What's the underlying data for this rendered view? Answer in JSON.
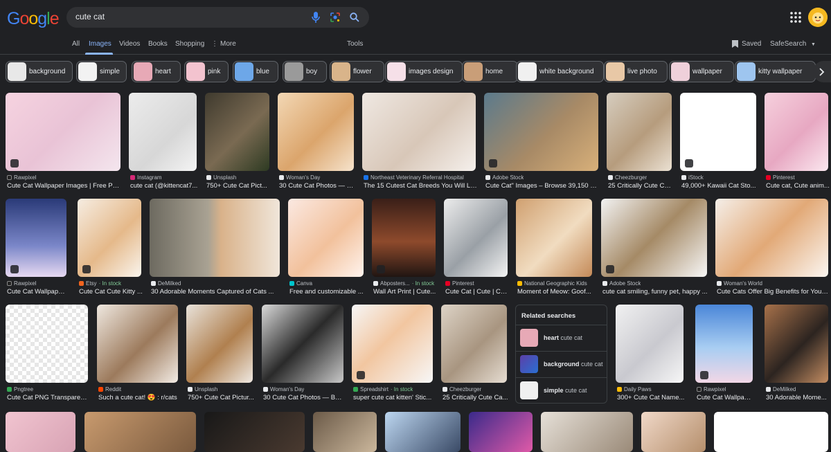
{
  "logo": "Google",
  "search": {
    "query": "cute cat"
  },
  "tabs": [
    "All",
    "Images",
    "Videos",
    "Books",
    "Shopping",
    "More",
    "Tools"
  ],
  "header_right": {
    "saved": "Saved",
    "safesearch": "SafeSearch"
  },
  "chips": [
    "background",
    "simple",
    "heart",
    "pink",
    "blue",
    "boy",
    "flower",
    "images design",
    "home",
    "white background",
    "live photo",
    "wallpaper",
    "kitty wallpaper"
  ],
  "row1": [
    {
      "source": "Rawpixel",
      "title": "Cute Cat Wallpaper Images | Free Pho..."
    },
    {
      "source": "Instagram",
      "title": "cute cat (@kittencat7..."
    },
    {
      "source": "Unsplash",
      "title": "750+ Cute Cat Pict..."
    },
    {
      "source": "Woman's Day",
      "title": "30 Cute Cat Photos — B..."
    },
    {
      "source": "Northeast Veterinary Referral Hospital",
      "title": "The 15 Cutest Cat Breeds You Will Lo..."
    },
    {
      "source": "Adobe Stock",
      "title": "Cute Cat\" Images – Browse 39,150 St..."
    },
    {
      "source": "Cheezburger",
      "title": "25 Critically Cute Ca..."
    },
    {
      "source": "iStock",
      "title": "49,000+ Kawaii Cat Sto..."
    },
    {
      "source": "Pinterest",
      "title": "Cute cat, Cute anim..."
    }
  ],
  "row2": [
    {
      "source": "Rawpixel",
      "title": "Cute Cat Wallpaper ..."
    },
    {
      "source": "Etsy",
      "stock": "· In stock",
      "title": "Cute Cat Cute Kitty ..."
    },
    {
      "source": "DeMilked",
      "title": "30 Adorable Moments Captured of Cats ..."
    },
    {
      "source": "Canva",
      "title": "Free and customizable ..."
    },
    {
      "source": "Abposters...",
      "stock": "· In stock",
      "title": "Wall Art Print | Cute..."
    },
    {
      "source": "Pinterest",
      "title": "Cute Cat | Cute | Cu..."
    },
    {
      "source": "National Geographic Kids",
      "title": "Moment of Meow: Goof..."
    },
    {
      "source": "Adobe Stock",
      "title": "cute cat smiling, funny pet, happy ..."
    },
    {
      "source": "Woman's World",
      "title": "Cute Cats Offer Big Benefits for Your ..."
    }
  ],
  "row3": [
    {
      "source": "Pngtree",
      "title": "Cute Cat PNG Transparent..."
    },
    {
      "source": "Reddit",
      "title": "Such a cute cat! 😍 : r/cats"
    },
    {
      "source": "Unsplash",
      "title": "750+ Cute Cat Pictur..."
    },
    {
      "source": "Woman's Day",
      "title": "30 Cute Cat Photos — Bes..."
    },
    {
      "source": "Spreadshirt",
      "stock": "· In stock",
      "title": "super cute cat kitten' Stic..."
    },
    {
      "source": "Cheezburger",
      "title": "25 Critically Cute Ca..."
    },
    {
      "source": "Daily Paws",
      "title": "300+ Cute Cat Name..."
    },
    {
      "source": "Rawpixel",
      "title": "Cute Cat Wallpaper ..."
    },
    {
      "source": "DeMilked",
      "title": "30 Adorable Mome..."
    }
  ],
  "related": {
    "title": "Related searches",
    "items": [
      {
        "bold": "heart",
        "rest": "cute cat"
      },
      {
        "bold": "background",
        "rest": "cute cat"
      },
      {
        "bold": "simple",
        "rest": "cute cat"
      }
    ]
  },
  "colors": {
    "background": "#202124",
    "accent": "#8ab4f8",
    "in_stock": "#81c995"
  }
}
